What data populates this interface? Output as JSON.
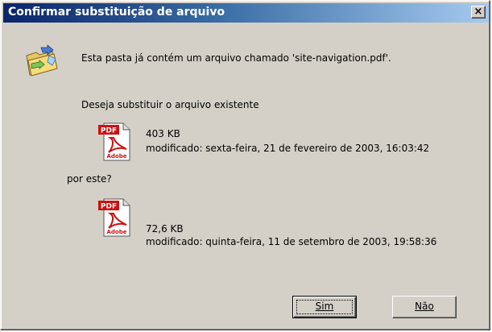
{
  "window": {
    "title": "Confirmar substituição de arquivo",
    "close_glyph": "×"
  },
  "message": {
    "exists": "Esta pasta já contém um arquivo chamado 'site-navigation.pdf'.",
    "question": "Deseja substituir o arquivo existente",
    "by_this": "por este?"
  },
  "existing_file": {
    "icon": "pdf-icon",
    "size": "403 KB",
    "modified": "modificado: sexta-feira, 21 de fevereiro de 2003, 16:03:42"
  },
  "new_file": {
    "icon": "pdf-icon",
    "size": "72,6 KB",
    "modified": "modificado: quinta-feira, 11 de setembro de 2003, 19:58:36"
  },
  "buttons": {
    "yes_label": "Sim",
    "no_label": "Não"
  },
  "icons": {
    "main": "folder-replace-icon",
    "pdf_badge_text": "PDF",
    "pdf_brand_text": "Adobe"
  },
  "colors": {
    "title_start": "#0a246a",
    "title_end": "#a6caf0",
    "face": "#d4d0c8",
    "pdf_red": "#cc1111"
  }
}
